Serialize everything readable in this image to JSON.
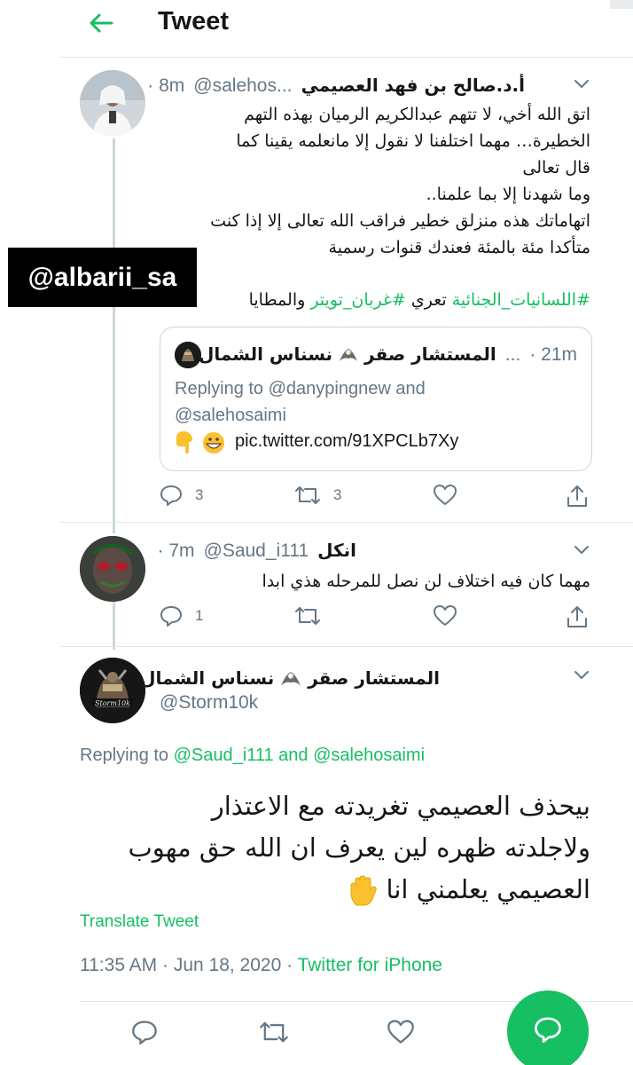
{
  "header": {
    "title": "Tweet"
  },
  "watermark": "@albarii_sa",
  "tweet1": {
    "name": "أ.د.صالح بن فهد العصيمي",
    "handle": "@salehos...",
    "time": "· 8m",
    "lines": [
      "اتق الله أخي، لا تتهم عبدالكريم الرميان بهذه التهم",
      "الخطيرة… مهما اختلفنا لا نقول إلا مانعلمه يقينا كما",
      "قال تعالى",
      "وما شهدنا إلا بما علمنا..",
      "اتهاماتك هذه منزلق خطير فراقب الله تعالى إلا إذا كنت",
      "متأكدا مئة بالمئة فعندك قنوات رسمية"
    ],
    "hashtags": {
      "tag1": "#اللسانيات_الجنائية",
      "word1": "تعري",
      "tag2": "#غربان_تويتر",
      "word2": "والمطايا"
    },
    "replies": "3",
    "retweets": "3"
  },
  "quote": {
    "name": "المستشار صقر",
    "name2": "نسناس الشمال",
    "dots": "...",
    "time": "· 21m",
    "replying_line1": "Replying to @danypingnew and",
    "replying_line2": "@salehosaimi",
    "link": "pic.twitter.com/91XPCLb7Xy"
  },
  "tweet2": {
    "name": "انكل",
    "handle": "@Saud_i111",
    "time": "· 7m",
    "text": "مهما كان فيه اختلاف لن نصل للمرحله هذي ابدا",
    "replies": "1"
  },
  "main": {
    "name": "المستشار صقر",
    "name2": "نسناس الشمال",
    "handle": "@Storm10k",
    "replying_prefix": "Replying to",
    "replying_user1": "@Saud_i111",
    "replying_and": "and",
    "replying_user2": "@salehosaimi",
    "lines": [
      "بيحذف العصيمي تغريدته مع الاعتذار",
      "ولاجلدته ظهره لين يعرف ان الله حق مهوب",
      "العصيمي يعلمني انا"
    ],
    "translate": "Translate Tweet",
    "timestamp": "11:35 AM · Jun 18, 2020 ·",
    "source": "Twitter for iPhone"
  },
  "colors": {
    "accent": "#17bf63",
    "secondary_text": "#657786",
    "primary_text": "#14171a",
    "border": "#ccd6dd"
  },
  "icons": [
    "back-arrow-icon",
    "chevron-down-icon",
    "reply-icon",
    "retweet-icon",
    "like-icon",
    "share-icon",
    "compose-reply-icon",
    "eagle-emoji-icon",
    "pointing-down-emoji-icon",
    "grinning-emoji-icon",
    "raised-hand-emoji-icon"
  ]
}
